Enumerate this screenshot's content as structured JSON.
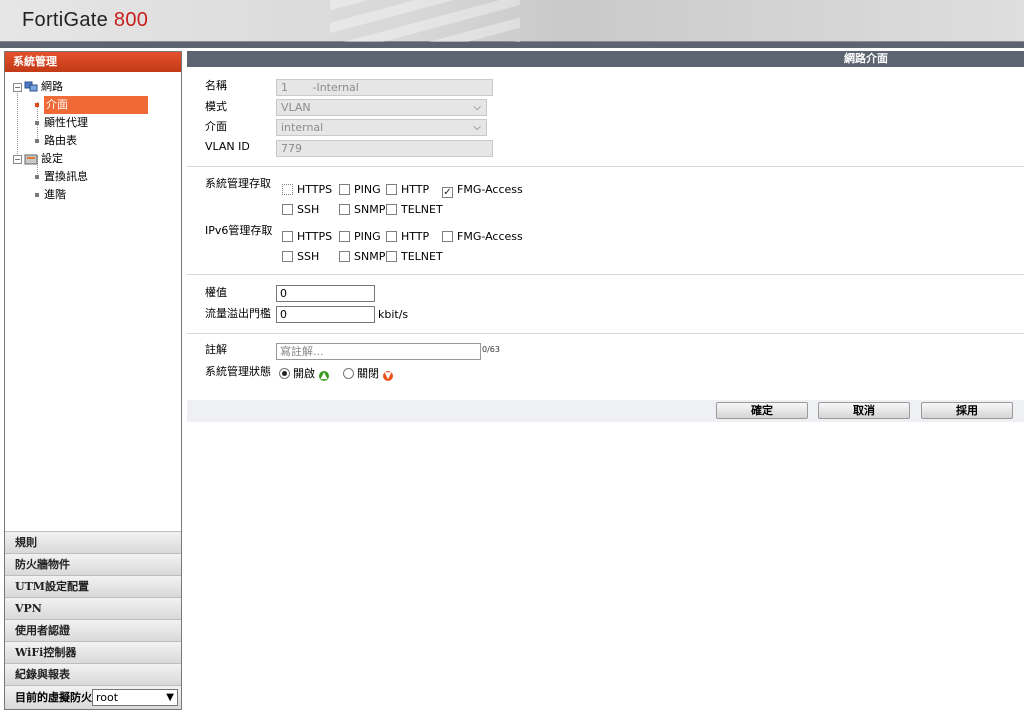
{
  "header": {
    "brand": "FortiGate",
    "model": "800"
  },
  "sidebar": {
    "title": "系統管理",
    "tree": {
      "network": "網路",
      "network_children": [
        "介面",
        "顯性代理",
        "路由表"
      ],
      "settings": "設定",
      "settings_children": [
        "置換訊息",
        "進階"
      ]
    },
    "menus": [
      "規則",
      "防火牆物件",
      "UTM設定配置",
      "VPN",
      "使用者認證",
      "WiFi控制器",
      "紀錄與報表"
    ],
    "vdom_label": "目前的虛擬防火牆",
    "vdom_value": "root"
  },
  "panel": {
    "title": "網路介面",
    "labels": {
      "name": "名稱",
      "mode": "模式",
      "interface": "介面",
      "vlan_id": "VLAN ID",
      "admin_access": "系統管理存取",
      "ipv6_admin_access": "IPv6管理存取",
      "weight": "權值",
      "spillover": "流量溢出門檻",
      "comment": "註解",
      "admin_status": "系統管理狀態"
    },
    "values": {
      "name": "1       -Internal",
      "mode": "VLAN",
      "interface": "internal",
      "vlan_id": "779",
      "weight": "0",
      "spillover": "0",
      "spillover_unit": "kbit/s",
      "comment_placeholder": "寫註解...",
      "comment_counter": "0/63"
    },
    "admin_access": [
      "HTTPS",
      "PING",
      "HTTP",
      "FMG-Access",
      "SSH",
      "SNMP",
      "TELNET"
    ],
    "ipv6_admin_access": [
      "HTTPS",
      "PING",
      "HTTP",
      "FMG-Access",
      "SSH",
      "SNMP",
      "TELNET"
    ],
    "status_options": {
      "up": "開啟",
      "down": "關閉"
    },
    "buttons": {
      "ok": "確定",
      "cancel": "取消",
      "apply": "採用"
    }
  },
  "colors": {
    "accent": "#c8201c",
    "selected": "#ef6a36",
    "title_bar": "#5b6470",
    "status_up": "#3a9a1e",
    "status_down": "#e8561c"
  }
}
